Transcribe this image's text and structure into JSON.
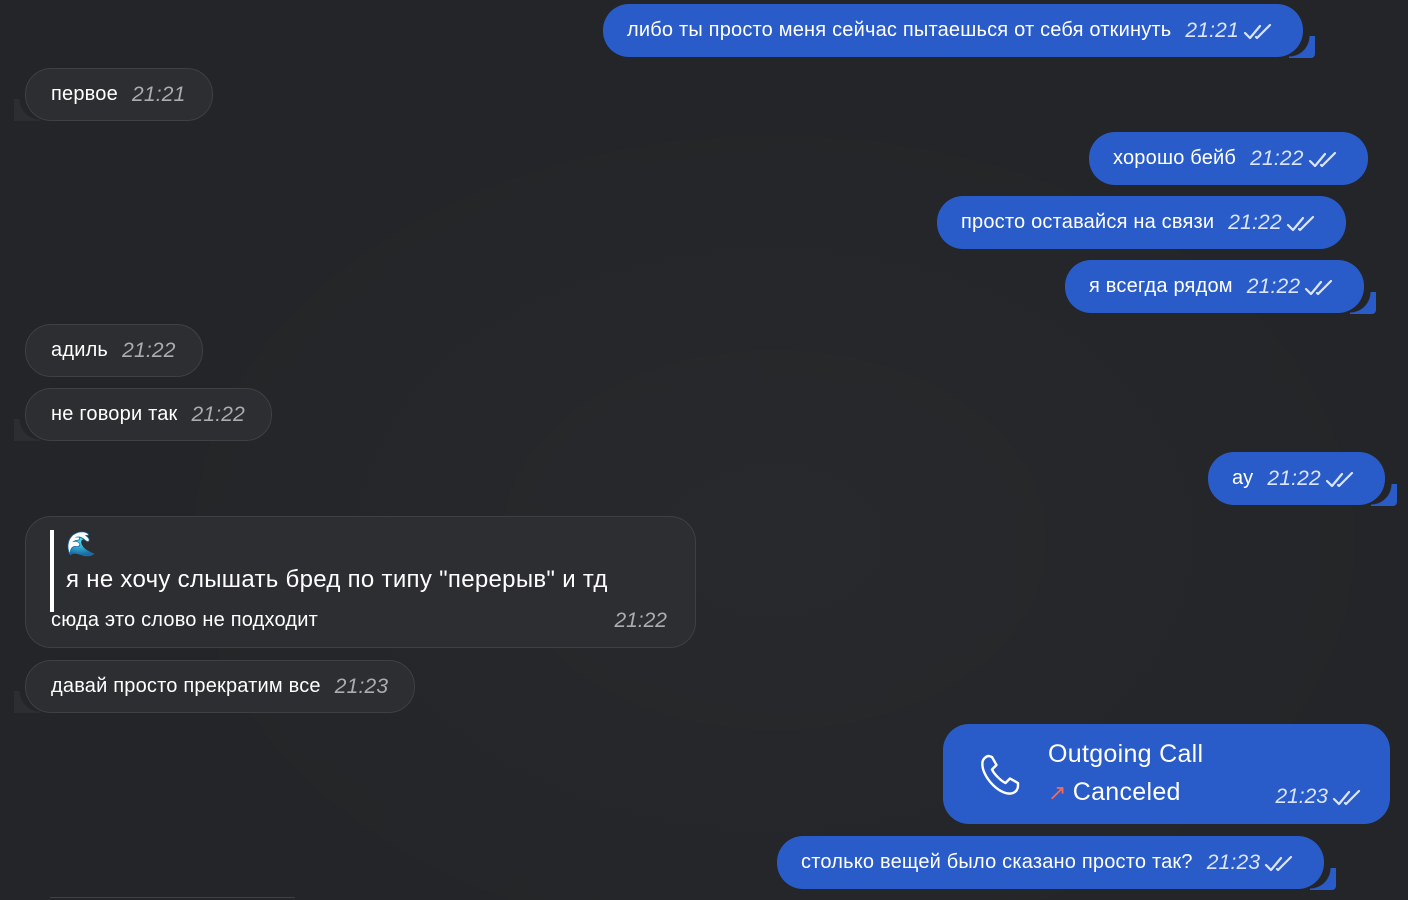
{
  "messages": [
    {
      "side": "out",
      "text": "либо ты просто меня сейчас пытаешься от себя откинуть",
      "time": "21:21"
    },
    {
      "side": "in",
      "text": "первое",
      "time": "21:21"
    },
    {
      "side": "out",
      "text": "хорошо бейб",
      "time": "21:22"
    },
    {
      "side": "out",
      "text": "просто оставайся на связи",
      "time": "21:22"
    },
    {
      "side": "out",
      "text": "я всегда рядом",
      "time": "21:22"
    },
    {
      "side": "in",
      "text": "адиль",
      "time": "21:22"
    },
    {
      "side": "in",
      "text": "не говори так",
      "time": "21:22"
    },
    {
      "side": "out",
      "text": "ау",
      "time": "21:22"
    },
    {
      "side": "in",
      "text": "давай просто прекратим все",
      "time": "21:23"
    },
    {
      "side": "out",
      "text": "столько вещей было сказано просто так?",
      "time": "21:23"
    }
  ],
  "quote_message": {
    "quote_emoji": "🌊",
    "quote_text": "я не хочу слышать бред по типу \"перерыв\" и тд",
    "reply_text": "сюда это слово не подходит",
    "time": "21:22"
  },
  "call_message": {
    "title": "Outgoing Call",
    "status_arrow": "↗",
    "status": "Canceled",
    "time": "21:23",
    "icon": "phone-icon"
  },
  "colors": {
    "background": "#232528",
    "outgoing_bubble": "#2a5cc9",
    "incoming_bubble": "#2c2e31",
    "canceled_arrow": "#ef6a5e"
  }
}
